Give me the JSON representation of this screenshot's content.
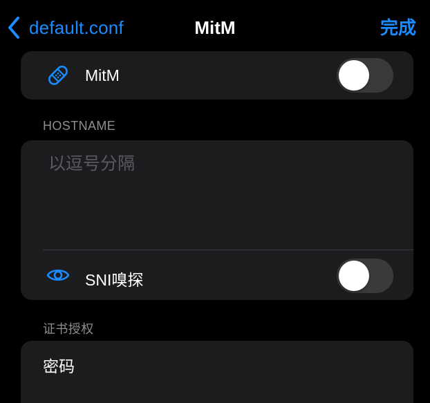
{
  "nav": {
    "back_label": "default.conf",
    "title": "MitM",
    "done_label": "完成"
  },
  "mitm_section": {
    "label": "MitM",
    "icon": "bandage-icon",
    "enabled": false
  },
  "hostname_section": {
    "header": "HOSTNAME",
    "placeholder": "以逗号分隔",
    "value": "",
    "sni_label": "SNI嗅探",
    "sni_icon": "eye-icon",
    "sni_enabled": false
  },
  "cert_section": {
    "header": "证书授权",
    "password_label": "密码"
  },
  "colors": {
    "accent": "#1a8cff",
    "background": "#000000",
    "card": "#1c1c1e",
    "secondary_text": "#8e8e93",
    "placeholder": "#5b5b5f",
    "toggle_off": "#3a3a3c"
  }
}
